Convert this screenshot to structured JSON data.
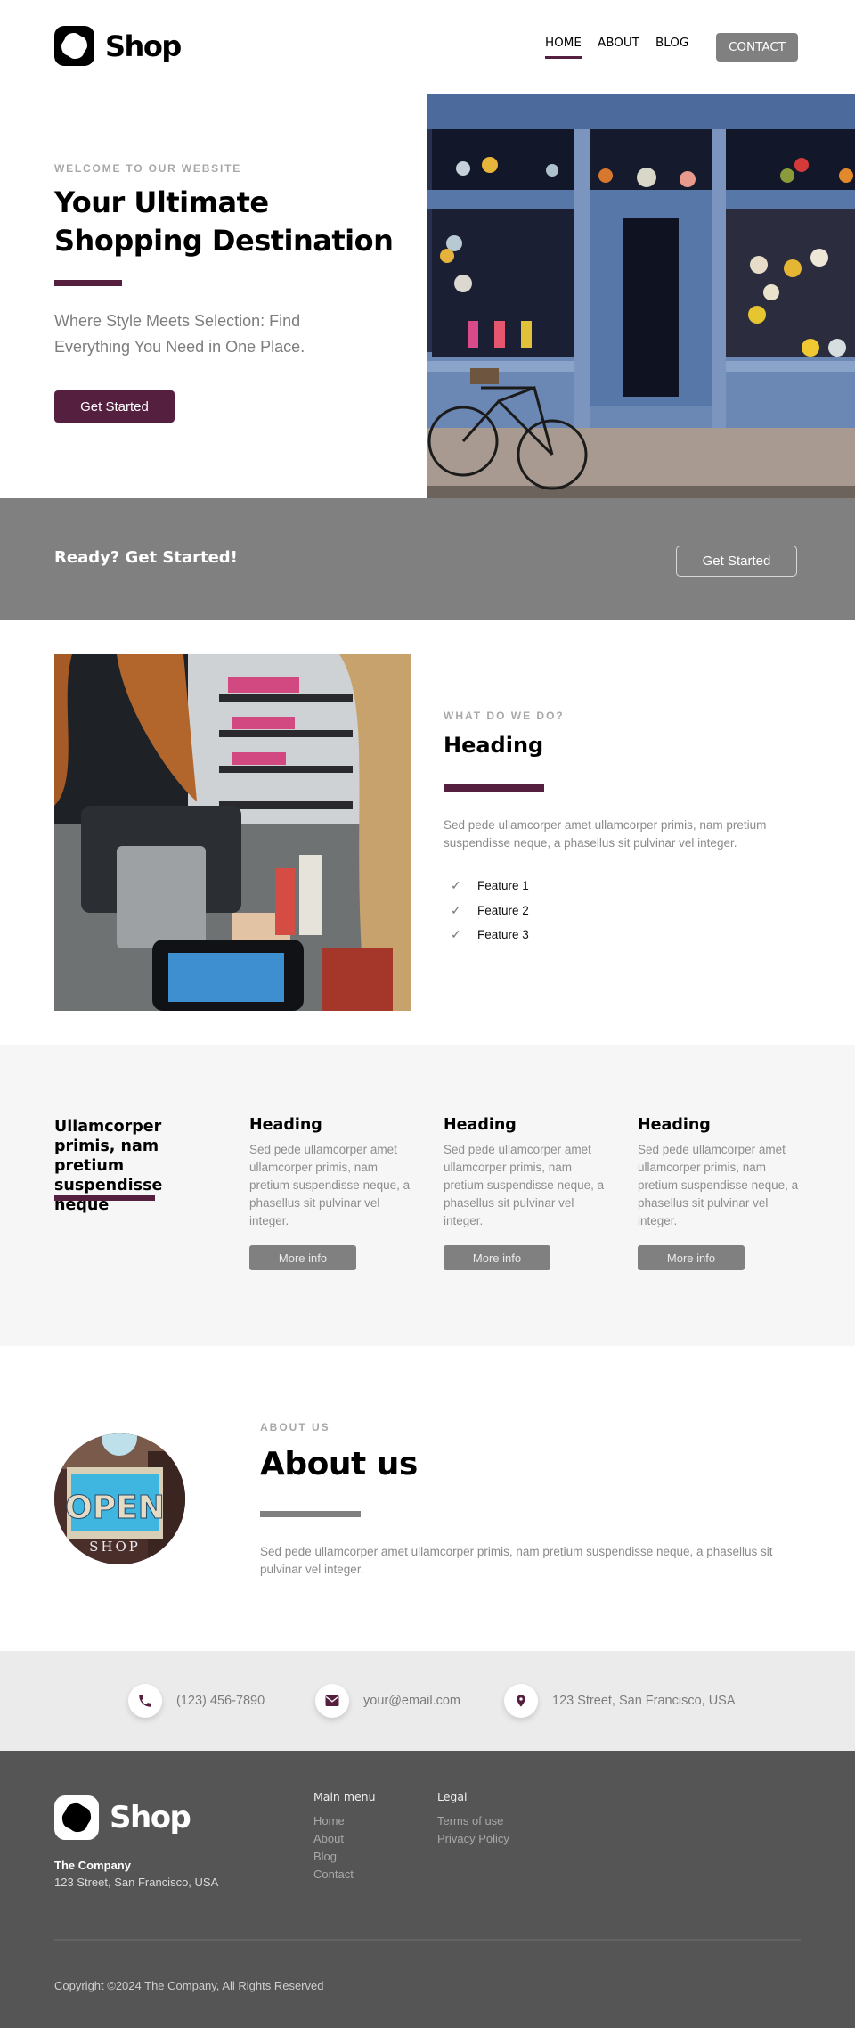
{
  "brand": {
    "name": "Shop",
    "accent_color": "#55203f",
    "gray_button_color": "#808080"
  },
  "header": {
    "nav": [
      {
        "label": "HOME",
        "active": true
      },
      {
        "label": "ABOUT",
        "active": false
      },
      {
        "label": "BLOG",
        "active": false
      }
    ],
    "contact_label": "CONTACT"
  },
  "hero": {
    "eyebrow": "WELCOME TO OUR WEBSITE",
    "title": "Your Ultimate Shopping Destination",
    "subtitle": "Where Style Meets Selection: Find Everything You Need in One Place.",
    "button_label": "Get Started",
    "image_alt": "Storefront with hanging lamps and a bicycle parked outside"
  },
  "ready_band": {
    "text": "Ready? Get Started!",
    "button_label": "Get Started"
  },
  "what_we_do": {
    "eyebrow": "WHAT DO WE DO?",
    "heading": "Heading",
    "text": "Sed pede ullamcorper amet ullamcorper primis, nam pretium suspendisse neque, a phasellus sit pulvinar vel integer.",
    "features": [
      "Feature 1",
      "Feature 2",
      "Feature 3"
    ],
    "image_alt": "Customer paying with card at a checkout terminal"
  },
  "info_section": {
    "title": "Ullamcorper primis, nam pretium suspendisse neque",
    "cards": [
      {
        "heading": "Heading",
        "text": "Sed pede ullamcorper amet ullamcorper primis, nam pretium suspendisse neque, a phasellus sit pulvinar vel integer.",
        "button_label": "More info"
      },
      {
        "heading": "Heading",
        "text": "Sed pede ullamcorper amet ullamcorper primis, nam pretium suspendisse neque, a phasellus sit pulvinar vel integer.",
        "button_label": "More info"
      },
      {
        "heading": "Heading",
        "text": "Sed pede ullamcorper amet ullamcorper primis, nam pretium suspendisse neque, a phasellus sit pulvinar vel integer.",
        "button_label": "More info"
      }
    ]
  },
  "about": {
    "eyebrow": "ABOUT US",
    "title": "About us",
    "text": "Sed pede ullamcorper amet ullamcorper primis, nam pretium suspendisse neque, a phasellus sit pulvinar vel integer.",
    "image_sign_main": "OPEN",
    "image_sign_sub": "SHOP"
  },
  "contact": {
    "phone": {
      "icon": "phone-icon",
      "text": "(123) 456-7890"
    },
    "email": {
      "icon": "envelope-icon",
      "text": "your@email.com"
    },
    "address": {
      "icon": "map-pin-icon",
      "text": "123 Street, San Francisco, USA"
    }
  },
  "footer": {
    "company": "The Company",
    "address": "123 Street, San Francisco, USA",
    "main_menu": {
      "heading": "Main menu",
      "links": [
        "Home",
        "About",
        "Blog",
        "Contact"
      ]
    },
    "legal": {
      "heading": "Legal",
      "links": [
        "Terms of use",
        "Privacy Policy"
      ]
    },
    "copyright": "Copyright ©2024 The Company, All Rights Reserved"
  }
}
